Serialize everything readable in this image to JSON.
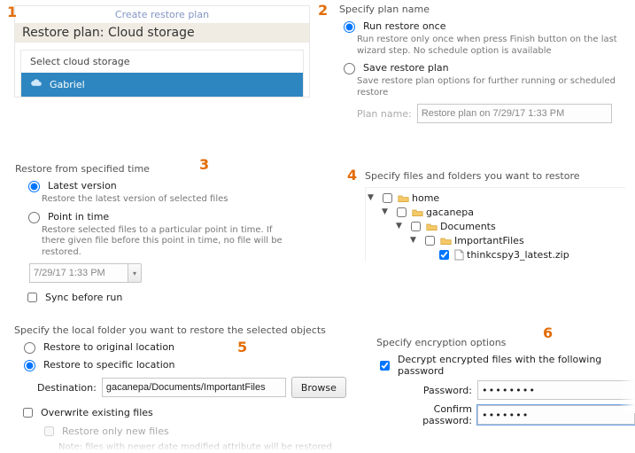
{
  "panel1": {
    "header_link": "Create restore plan",
    "title": "Restore plan: Cloud storage",
    "select_label": "Select cloud storage",
    "storage_name": "Gabriel"
  },
  "panel2": {
    "title": "Specify plan name",
    "opt_once_label": "Run restore once",
    "opt_once_desc": "Run restore only once when press Finish button on the last wizard step. No schedule option is available",
    "opt_save_label": "Save restore plan",
    "opt_save_desc": "Save restore plan options for further running or scheduled restore",
    "plan_name_label": "Plan name:",
    "plan_name_value": "Restore plan on 7/29/17 1:33 PM"
  },
  "panel3": {
    "title": "Restore from specified time",
    "opt_latest_label": "Latest version",
    "opt_latest_desc": "Restore the latest version of selected files",
    "opt_point_label": "Point in time",
    "opt_point_desc": "Restore selected files to a particular point in time. If there given file before this point in time, no file will be restored.",
    "datetime": "7/29/17 1:33 PM",
    "sync_label": "Sync before run"
  },
  "panel4": {
    "title": "Specify files and folders you want to restore",
    "tree": {
      "n0": "home",
      "n1": "gacanepa",
      "n2": "Documents",
      "n3": "ImportantFiles",
      "n4": "thinkcspy3_latest.zip"
    }
  },
  "panel5": {
    "title": "Specify the local folder you want to restore the selected objects",
    "opt_orig": "Restore to original location",
    "opt_spec": "Restore to specific location",
    "dest_label": "Destination:",
    "dest_value": "gacanepa/Documents/ImportantFiles",
    "browse": "Browse",
    "overwrite": "Overwrite existing files",
    "only_new": "Restore only new files",
    "only_new_note": "Note: files with newer date modified attribute will be restored"
  },
  "panel6": {
    "title": "Specify encryption options",
    "decrypt_label": "Decrypt encrypted files with the following password",
    "pw_label": "Password:",
    "pw_value": "••••••••",
    "confirm_label": "Confirm password:",
    "confirm_value": "•••••••"
  },
  "nums": {
    "n1": "1",
    "n2": "2",
    "n3": "3",
    "n4": "4",
    "n5": "5",
    "n6": "6"
  }
}
